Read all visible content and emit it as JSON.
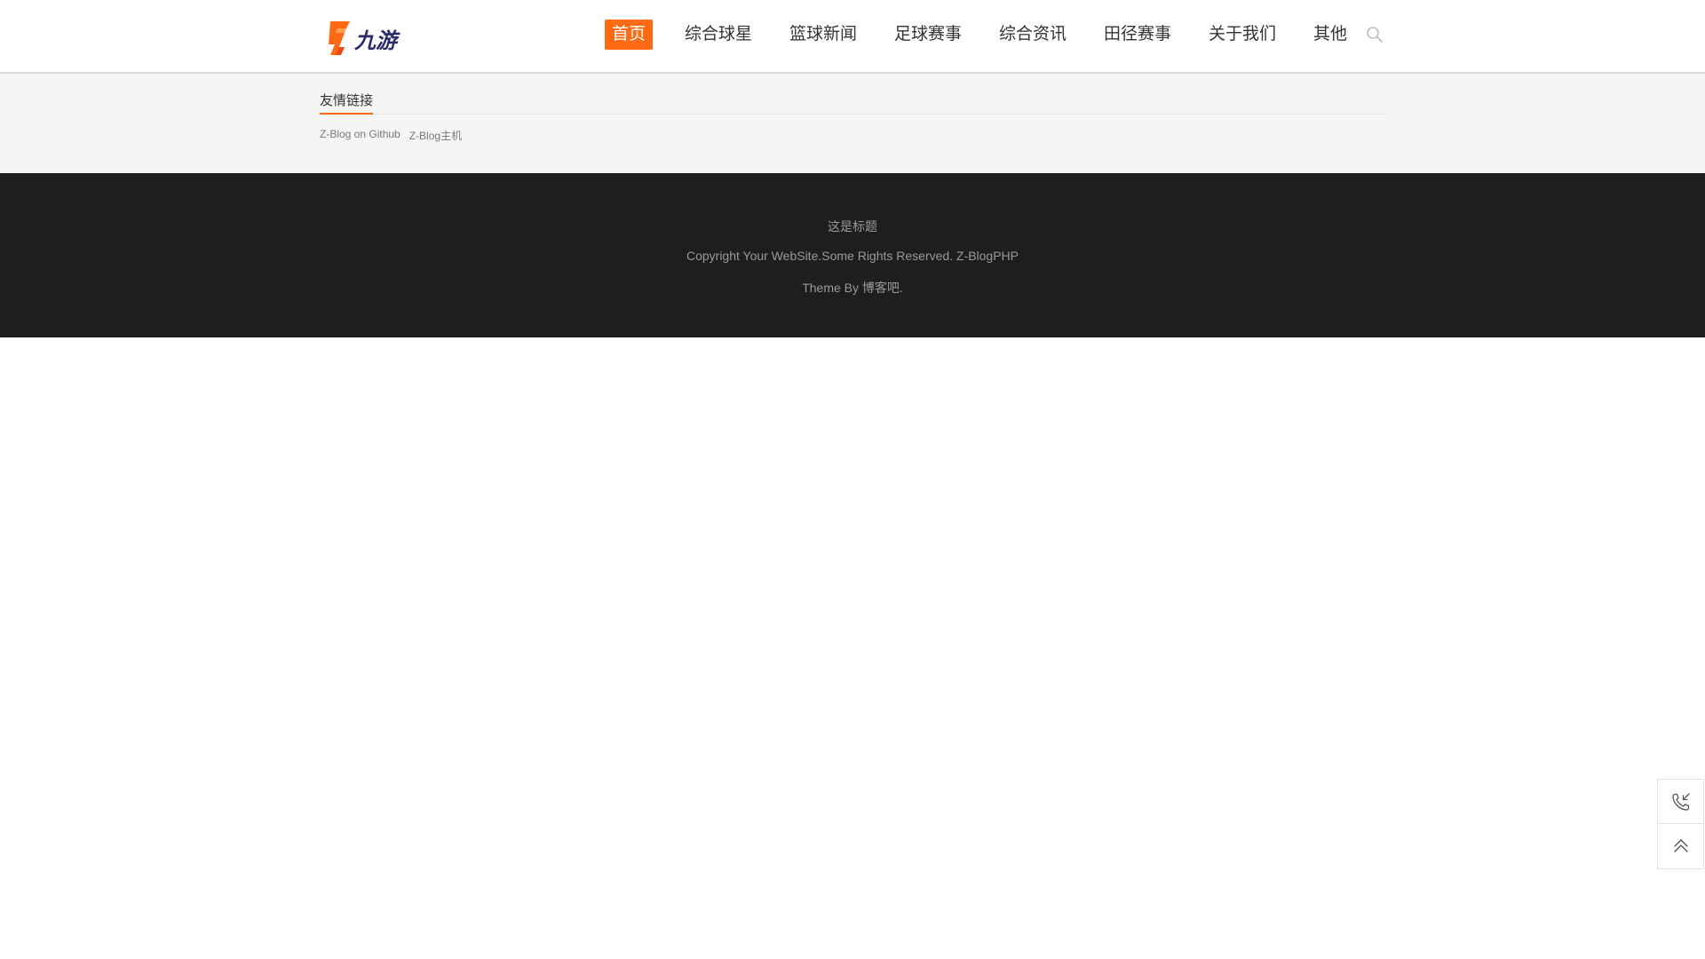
{
  "header": {
    "logo_text": "九游",
    "nav": [
      {
        "label": "首页",
        "active": true
      },
      {
        "label": "综合球星",
        "active": false
      },
      {
        "label": "篮球新闻",
        "active": false
      },
      {
        "label": "足球赛事",
        "active": false
      },
      {
        "label": "综合资讯",
        "active": false
      },
      {
        "label": "田径赛事",
        "active": false
      },
      {
        "label": "关于我们",
        "active": false
      },
      {
        "label": "其他",
        "active": false
      }
    ],
    "search_icon": "search-icon"
  },
  "friend_links": {
    "title": "友情链接",
    "items": [
      {
        "label": "Z-Blog on Github"
      },
      {
        "label": "Z-Blog主机"
      }
    ]
  },
  "footer": {
    "title": "这是标题",
    "copyright": "Copyright Your WebSite.Some Rights Reserved.",
    "powered_by": "Z-BlogPHP",
    "theme_prefix": "Theme By",
    "theme_author": "博客吧",
    "theme_suffix": "."
  },
  "side_tools": {
    "contact_icon": "phone-icon",
    "top_icon": "double-chevron-up-icon"
  },
  "colors": {
    "accent": "#ff6a13",
    "footer_bg": "#1e1e1e",
    "band_bg": "#f5f5f5"
  }
}
